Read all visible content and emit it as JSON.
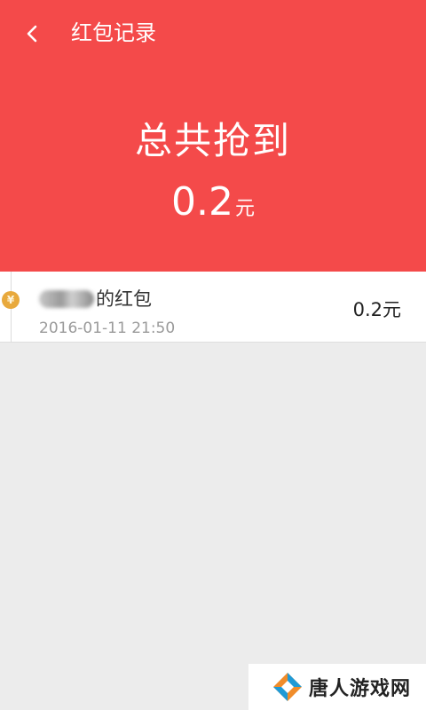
{
  "header": {
    "title": "红包记录",
    "back_icon": "chevron-left-icon"
  },
  "summary": {
    "label": "总共抢到",
    "amount": "0.2",
    "unit": "元"
  },
  "records": [
    {
      "sender_suffix": "的红包",
      "time": "2016-01-11 21:50",
      "amount": "0.2元",
      "icon": "coin-icon",
      "icon_glyph": "¥"
    }
  ],
  "watermark": {
    "text": "唐人游戏网"
  },
  "colors": {
    "header_bg": "#f44a4a",
    "page_bg": "#ececec",
    "coin": "#e8a93c"
  }
}
